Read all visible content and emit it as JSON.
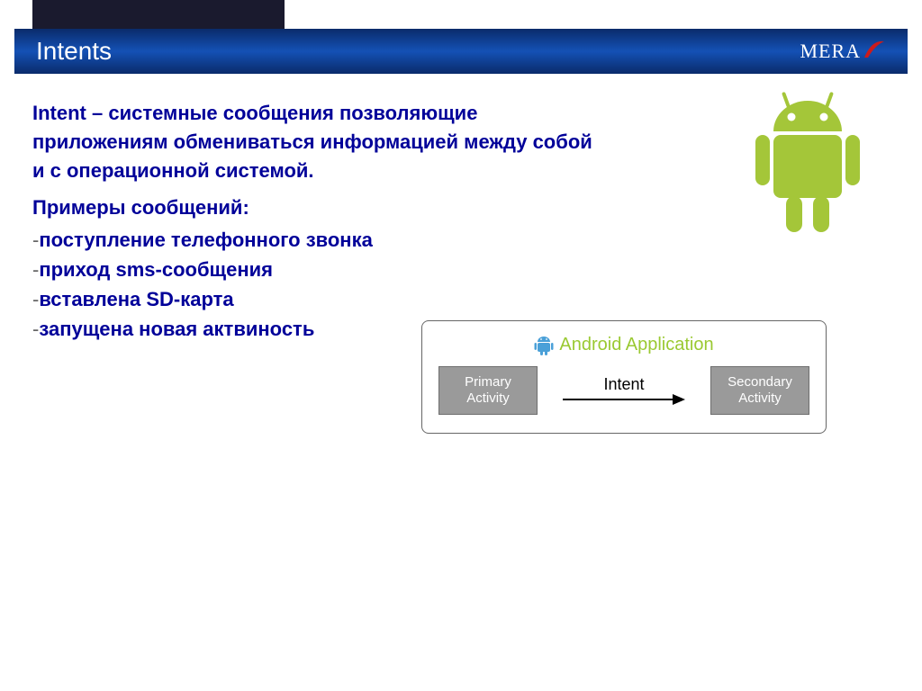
{
  "header": {
    "title": "Intents",
    "logo_text": "MERA"
  },
  "body": {
    "intro": "Intent – системные сообщения позволяющие приложениям обмениваться информацией между собой и с операционной системой.",
    "examples_heading": "Примеры сообщений:",
    "bullets": [
      "поступление телефонного звонка",
      "приход sms-сообщения",
      "вставлена SD-карта",
      "запущена новая актвиность"
    ]
  },
  "diagram": {
    "title": "Android Application",
    "box1_line1": "Primary",
    "box1_line2": "Activity",
    "arrow_label": "Intent",
    "box2_line1": "Secondary",
    "box2_line2": "Activity"
  }
}
